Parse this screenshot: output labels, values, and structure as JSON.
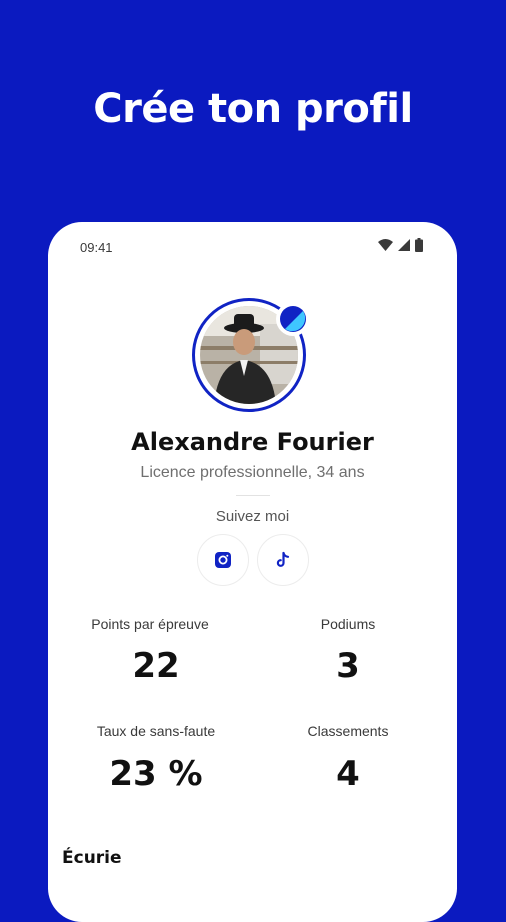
{
  "headline": "Crée ton profil",
  "status": {
    "time": "09:41"
  },
  "profile": {
    "name": "Alexandre Fourier",
    "subtitle": "Licence professionnelle, 34 ans",
    "follow_label": "Suivez moi",
    "socials": [
      "instagram-icon",
      "tiktok-icon"
    ]
  },
  "stats": [
    {
      "label": "Points par épreuve",
      "value": "22"
    },
    {
      "label": "Podiums",
      "value": "3"
    },
    {
      "label": "Taux de sans-faute",
      "value": "23 %"
    },
    {
      "label": "Classements",
      "value": "4"
    }
  ],
  "section_title": "Écurie",
  "colors": {
    "brand_blue": "#0b1ac0",
    "accent_cyan": "#3fc6ff"
  }
}
